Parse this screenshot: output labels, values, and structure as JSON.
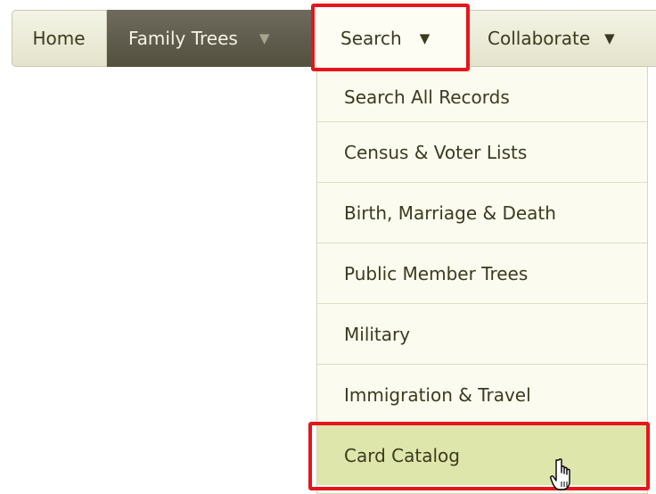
{
  "nav": {
    "home_label": "Home",
    "family_trees_label": "Family Trees",
    "search_label": "Search",
    "collaborate_label": "Collaborate",
    "caret": "▼"
  },
  "dropdown": {
    "items": [
      {
        "label": "Search All Records"
      },
      {
        "label": "Census & Voter Lists"
      },
      {
        "label": "Birth, Marriage & Death"
      },
      {
        "label": "Public Member Trees"
      },
      {
        "label": "Military"
      },
      {
        "label": "Immigration & Travel"
      },
      {
        "label": "Card Catalog"
      }
    ],
    "hovered_item": "Card Catalog"
  },
  "icons": {
    "cursor": "hand-pointer-icon",
    "dropdown_caret": "caret-down-icon"
  },
  "colors": {
    "highlight": "#e5161b",
    "active_tab_bg": "#54503f",
    "hover_item_bg": "#dfe6ab",
    "menu_bg": "#fbfbef",
    "text": "#3c3a1e"
  }
}
